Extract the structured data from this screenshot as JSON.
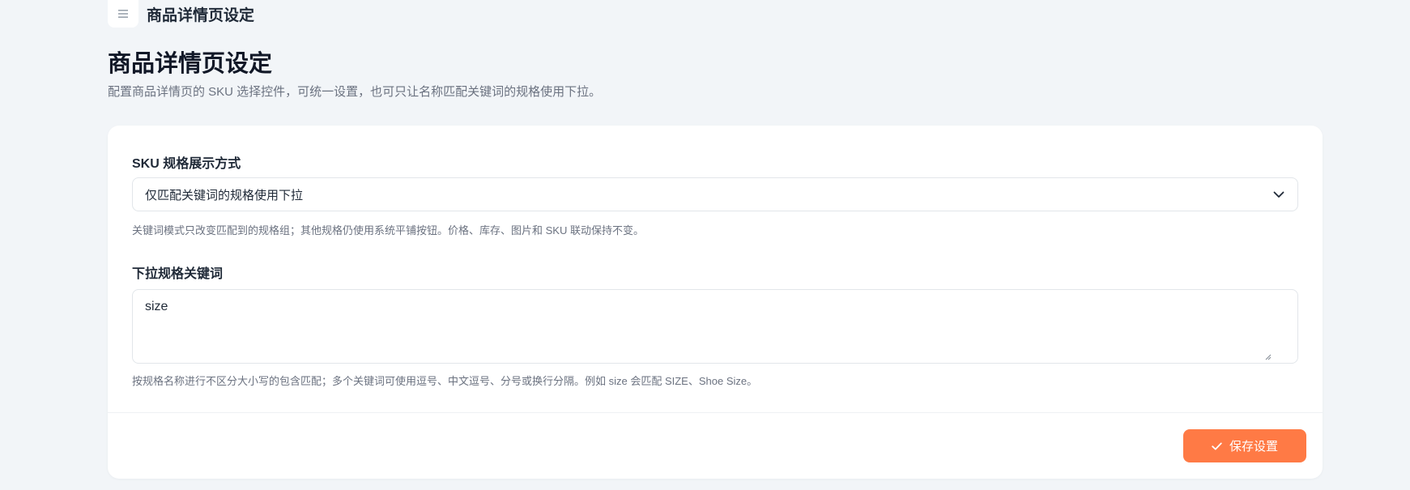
{
  "header": {
    "title": "商品详情页设定",
    "menu_icon": "hamburger-menu-icon"
  },
  "page": {
    "title": "商品详情页设定",
    "description": "配置商品详情页的 SKU 选择控件，可统一设置，也可只让名称匹配关键词的规格使用下拉。"
  },
  "form": {
    "display_mode": {
      "label": "SKU 规格展示方式",
      "selected": "仅匹配关键词的规格使用下拉",
      "help": "关键词模式只改变匹配到的规格组；其他规格仍使用系统平铺按钮。价格、库存、图片和 SKU 联动保持不变。"
    },
    "keywords": {
      "label": "下拉规格关键词",
      "value": "size",
      "help": "按规格名称进行不区分大小写的包含匹配；多个关键词可使用逗号、中文逗号、分号或换行分隔。例如 size 会匹配 SIZE、Shoe Size。"
    }
  },
  "actions": {
    "save_label": "保存设置",
    "save_icon": "check-icon"
  },
  "colors": {
    "background": "#f2f5f8",
    "card": "#ffffff",
    "accent": "#ff7a45",
    "muted_text": "#6b7280",
    "border": "#e2e6ea"
  }
}
